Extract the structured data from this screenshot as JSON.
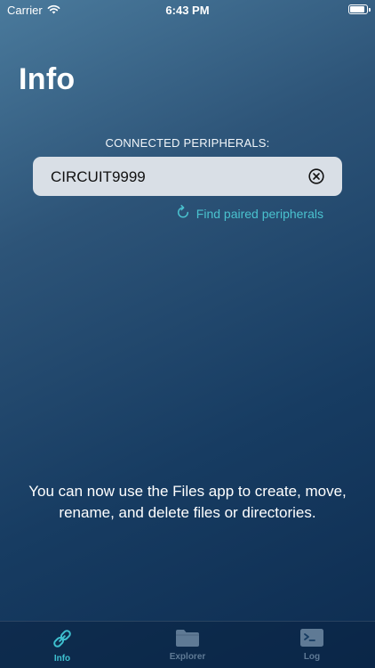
{
  "status_bar": {
    "carrier": "Carrier",
    "time": "6:43 PM",
    "battery_level": 0.95
  },
  "page": {
    "title": "Info"
  },
  "peripherals": {
    "section_label": "CONNECTED PERIPHERALS:",
    "current_value": "CIRCUIT9999",
    "find_label": "Find paired peripherals"
  },
  "message": "You can now use the Files app to create, move, rename, and delete files or directories.",
  "tabs": [
    {
      "label": "Info",
      "icon": "link-icon",
      "active": true
    },
    {
      "label": "Explorer",
      "icon": "folder-icon",
      "active": false
    },
    {
      "label": "Log",
      "icon": "terminal-icon",
      "active": false
    }
  ],
  "colors": {
    "accent": "#3ec0cf",
    "inactive_tab": "#5f7a95",
    "field_background": "#d9dfe6"
  }
}
